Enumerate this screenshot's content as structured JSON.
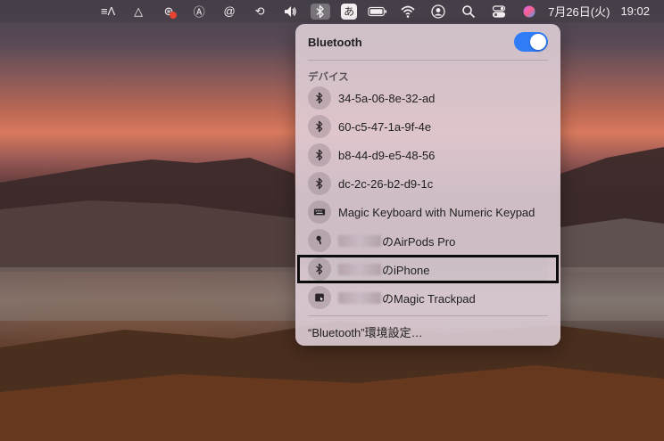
{
  "menubar": {
    "items": [
      {
        "name": "flags-app-icon",
        "glyph": "≡Λ"
      },
      {
        "name": "drive-icon",
        "glyph": "△"
      },
      {
        "name": "creative-cloud-icon",
        "glyph": "⊛"
      },
      {
        "name": "adobe-icon",
        "glyph": "Ⓐ"
      },
      {
        "name": "at-sign-icon",
        "glyph": "@"
      },
      {
        "name": "time-machine-icon",
        "glyph": "⟲"
      },
      {
        "name": "volume-icon",
        "glyph": "🔊"
      },
      {
        "name": "bluetooth-icon",
        "glyph": "ᛒ"
      },
      {
        "name": "input-method-icon",
        "glyph": "あ"
      },
      {
        "name": "battery-icon",
        "glyph": "▭"
      },
      {
        "name": "wifi-icon",
        "glyph": "◠"
      },
      {
        "name": "user-icon",
        "glyph": "◉"
      },
      {
        "name": "spotlight-search-icon",
        "glyph": "⌕"
      },
      {
        "name": "control-center-icon",
        "glyph": "⊜"
      },
      {
        "name": "siri-icon",
        "glyph": "◐"
      }
    ],
    "date": "7月26日(火)",
    "time": "19:02"
  },
  "bluetooth": {
    "title": "Bluetooth",
    "enabled": true,
    "section_label": "デバイス",
    "devices": [
      {
        "label": "34-5a-06-8e-32-ad",
        "icon": "bluetooth-icon",
        "redacted": false
      },
      {
        "label": "60-c5-47-1a-9f-4e",
        "icon": "bluetooth-icon",
        "redacted": false
      },
      {
        "label": "b8-44-d9-e5-48-56",
        "icon": "bluetooth-icon",
        "redacted": false
      },
      {
        "label": "dc-2c-26-b2-d9-1c",
        "icon": "bluetooth-icon",
        "redacted": false
      },
      {
        "label": "Magic Keyboard with Numeric Keypad",
        "icon": "keyboard-icon",
        "redacted": false
      },
      {
        "label": "のAirPods Pro",
        "icon": "airpods-icon",
        "redacted": true
      },
      {
        "label": "のiPhone",
        "icon": "bluetooth-icon",
        "redacted": true
      },
      {
        "label": "のMagic Trackpad",
        "icon": "trackpad-icon",
        "redacted": true
      }
    ],
    "settings_link": "“Bluetooth”環境設定…",
    "accent_color": "#2f7cf6"
  }
}
